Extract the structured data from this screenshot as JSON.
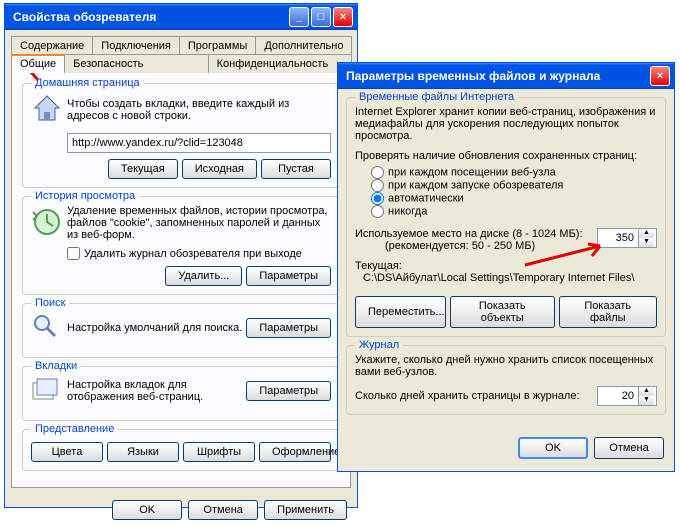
{
  "win1": {
    "title": "Свойства обозревателя",
    "tabs_row1": [
      "Содержание",
      "Подключения",
      "Программы",
      "Дополнительно"
    ],
    "tabs_row2": [
      "Общие",
      "Безопасность",
      "Конфиденциальность"
    ],
    "active_tab": "Общие",
    "home": {
      "legend": "Домашняя страница",
      "desc": "Чтобы создать вкладки, введите каждый из адресов с новой строки.",
      "url": "http://www.yandex.ru/?clid=123048",
      "btn_current": "Текущая",
      "btn_default": "Исходная",
      "btn_blank": "Пустая"
    },
    "history": {
      "legend": "История просмотра",
      "desc": "Удаление временных файлов, истории просмотра, файлов \"cookie\", запомненных паролей и данных из веб-форм.",
      "chk_label": "Удалить журнал обозревателя при выходе",
      "btn_delete": "Удалить...",
      "btn_params": "Параметры"
    },
    "search": {
      "legend": "Поиск",
      "desc": "Настройка умолчаний для поиска.",
      "btn": "Параметры"
    },
    "tabs_section": {
      "legend": "Вкладки",
      "desc": "Настройка вкладок для отображения веб-страниц.",
      "btn": "Параметры"
    },
    "appearance": {
      "legend": "Представление",
      "btn_colors": "Цвета",
      "btn_lang": "Языки",
      "btn_fonts": "Шрифты",
      "btn_style": "Оформление"
    },
    "dlg": {
      "ok": "OK",
      "cancel": "Отмена",
      "apply": "Применить"
    }
  },
  "win2": {
    "title": "Параметры временных файлов и журнала",
    "temp": {
      "legend": "Временные файлы Интернета",
      "desc": "Internet Explorer хранит копии веб-страниц, изображения и медиафайлы для ускорения последующих попыток просмотра.",
      "check_label": "Проверять наличие обновления сохраненных страниц:",
      "radio1": "при каждом посещении веб-узла",
      "radio2": "при каждом запуске обозревателя",
      "radio3": "автоматически",
      "radio4": "никогда",
      "disk_label": "Используемое место на диске (8 - 1024 МБ):",
      "disk_rec": "(рекомендуется: 50 - 250 МБ)",
      "disk_value": "350",
      "current_label": "Текущая:",
      "current_path": "C:\\DS\\Айбулат\\Local Settings\\Temporary Internet Files\\",
      "btn_move": "Переместить...",
      "btn_objects": "Показать объекты",
      "btn_files": "Показать файлы"
    },
    "journal": {
      "legend": "Журнал",
      "desc": "Укажите, сколько дней нужно хранить список посещенных вами веб-узлов.",
      "days_label": "Сколько дней хранить страницы в журнале:",
      "days_value": "20"
    },
    "dlg": {
      "ok": "OK",
      "cancel": "Отмена"
    }
  }
}
